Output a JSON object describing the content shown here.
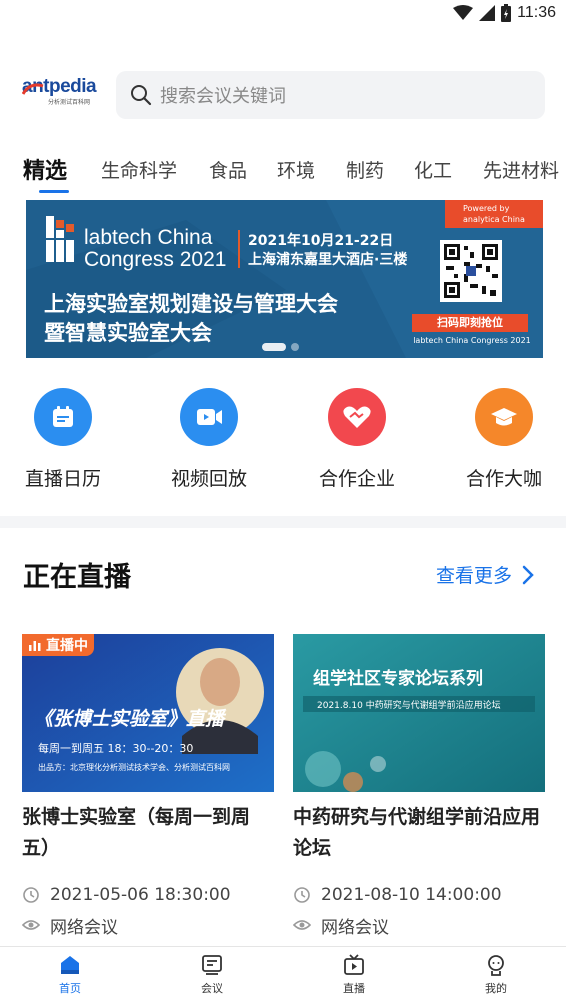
{
  "status_bar": {
    "time": "11:36"
  },
  "header": {
    "logo_text": "antpedia",
    "logo_sub": "分析测试百科网",
    "search_placeholder": "搜索会议关键词"
  },
  "tabs": [
    {
      "label": "精选"
    },
    {
      "label": "生命科学"
    },
    {
      "label": "食品"
    },
    {
      "label": "环境"
    },
    {
      "label": "制药"
    },
    {
      "label": "化工"
    },
    {
      "label": "先进材料"
    }
  ],
  "banner": {
    "brand_line1": "labtech China",
    "brand_line2": "Congress 2021",
    "date": "2021年10月21-22日",
    "venue": "上海浦东嘉里大酒店·三楼",
    "headline1": "上海实验室规划建设与管理大会",
    "headline2": "暨智慧实验室大会",
    "powered": "Powered by",
    "powered_by": "analytica China",
    "scan_label": "扫码即刻抢位",
    "footer": "labtech China Congress 2021"
  },
  "quick_entries": [
    {
      "label": "直播日历",
      "icon": "calendar-icon",
      "color": "#2b8ef0"
    },
    {
      "label": "视频回放",
      "icon": "video-icon",
      "color": "#2b8ef0"
    },
    {
      "label": "合作企业",
      "icon": "handshake-icon",
      "color": "#f2484e"
    },
    {
      "label": "合作大咖",
      "icon": "graduation-cap-icon",
      "color": "#f5872a"
    }
  ],
  "live_section": {
    "title": "正在直播",
    "more_label": "查看更多"
  },
  "cards": [
    {
      "badge": "直播中",
      "img_title": "《张博士实验室》直播",
      "img_schedule": "每周一到周五  18：30--20：30",
      "img_org": "出品方：北京理化分析测试技术学会、分析测试百科网",
      "title": "张博士实验室（每周一到周五）",
      "time": "2021-05-06 18:30:00",
      "type": "网络会议"
    },
    {
      "img_title": "组学社区专家论坛系列",
      "img_sub": "2021.8.10  中药研究与代谢组学前沿应用论坛",
      "title": "中药研究与代谢组学前沿应用论坛",
      "time": "2021-08-10 14:00:00",
      "type": "网络会议"
    }
  ],
  "bottom_nav": [
    {
      "label": "首页",
      "icon": "home-icon",
      "active": true
    },
    {
      "label": "会议",
      "icon": "meeting-icon",
      "active": false
    },
    {
      "label": "直播",
      "icon": "live-tv-icon",
      "active": false
    },
    {
      "label": "我的",
      "icon": "profile-icon",
      "active": false
    }
  ],
  "colors": {
    "accent": "#1a73e8",
    "live_badge": "#f26a2d"
  }
}
